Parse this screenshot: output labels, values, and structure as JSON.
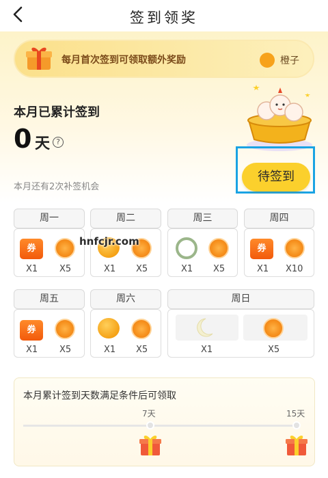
{
  "header": {
    "title": "签到领奖",
    "back_icon": "chevron-left-icon"
  },
  "banner": {
    "text": "每月首次签到可领取额外奖励",
    "reward_label": "橙子"
  },
  "summary": {
    "label": "本月已累计签到",
    "days": "0",
    "unit": "天",
    "remedy": "本月还有2次补签机会"
  },
  "sign_button": {
    "label": "待签到"
  },
  "days": [
    {
      "tab": "周一",
      "rewards": [
        {
          "icon": "coupon-icon",
          "text": "券",
          "count": "X1"
        },
        {
          "icon": "orange-icon",
          "count": "X5"
        }
      ]
    },
    {
      "tab": "周二",
      "rewards": [
        {
          "icon": "orange-icon",
          "count": "X1"
        },
        {
          "icon": "orange-icon",
          "count": "X5"
        }
      ]
    },
    {
      "tab": "周三",
      "rewards": [
        {
          "icon": "wreath-icon",
          "count": "X1"
        },
        {
          "icon": "orange-icon",
          "count": "X5"
        }
      ]
    },
    {
      "tab": "周四",
      "rewards": [
        {
          "icon": "coupon-icon",
          "text": "券",
          "count": "X1"
        },
        {
          "icon": "orange-icon",
          "count": "X10"
        }
      ]
    },
    {
      "tab": "周五",
      "rewards": [
        {
          "icon": "coupon-icon",
          "text": "券",
          "count": "X1"
        },
        {
          "icon": "orange-icon",
          "count": "X5"
        }
      ]
    },
    {
      "tab": "周六",
      "rewards": [
        {
          "icon": "orange-icon",
          "count": "X1"
        },
        {
          "icon": "orange-icon",
          "count": "X5"
        }
      ]
    },
    {
      "tab": "周日",
      "rewards": [
        {
          "icon": "moon-icon",
          "count": "X1"
        },
        {
          "icon": "orange-icon",
          "count": "X5"
        }
      ]
    }
  ],
  "watermark": "hnfcjr.com",
  "progress": {
    "title": "本月累计签到天数满足条件后可领取",
    "milestones": [
      {
        "label": "7天"
      },
      {
        "label": "15天"
      }
    ]
  },
  "colors": {
    "accent": "#fbd02c",
    "highlight": "#1aa3e3",
    "coupon": "#f25a0c",
    "orange": "#f6911e"
  }
}
